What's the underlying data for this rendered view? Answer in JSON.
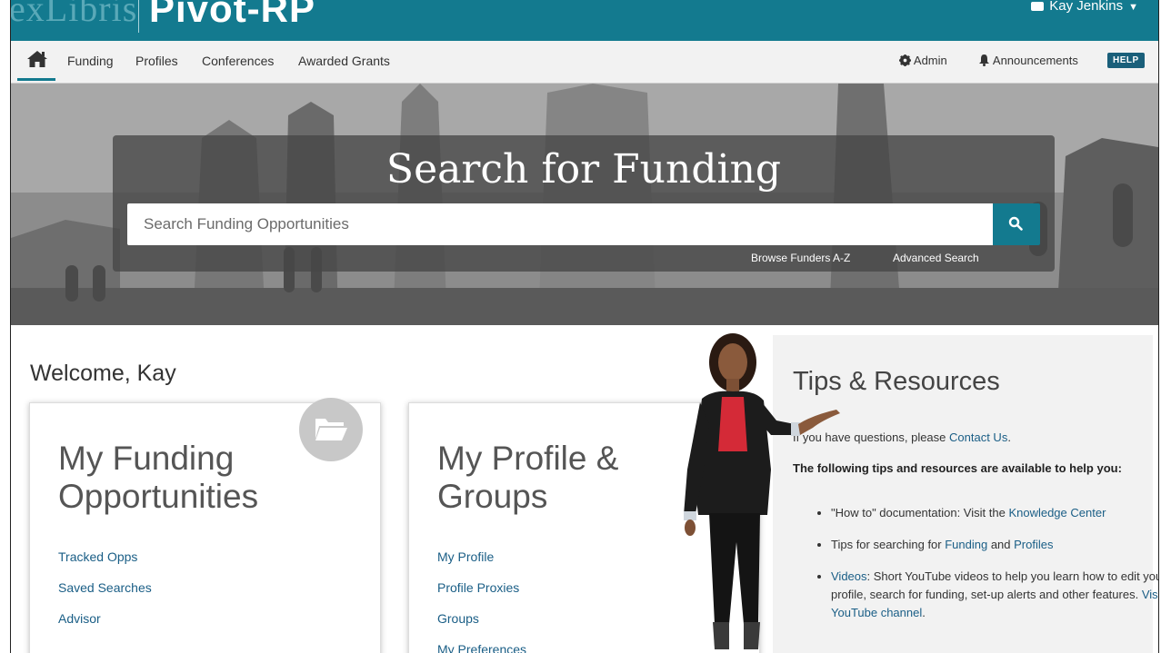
{
  "brand": {
    "prefix": "exLibris",
    "product": "Pivot-RP"
  },
  "user": {
    "name": "Kay Jenkins"
  },
  "nav": {
    "links": [
      "Funding",
      "Profiles",
      "Conferences",
      "Awarded Grants"
    ],
    "admin": "Admin",
    "announcements": "Announcements",
    "help": "HELP"
  },
  "search": {
    "title": "Search for Funding",
    "placeholder": "Search Funding Opportunities",
    "browse": "Browse Funders A-Z",
    "advanced": "Advanced Search"
  },
  "welcome": "Welcome, Kay",
  "card_funding": {
    "title_line1": "My Funding",
    "title_line2": "Opportunities",
    "links": [
      "Tracked Opps",
      "Saved Searches",
      "Advisor"
    ]
  },
  "card_profile": {
    "title_line1": "My Profile &",
    "title_line2": "Groups",
    "links": [
      "My Profile",
      "Profile Proxies",
      "Groups",
      "My Preferences"
    ]
  },
  "tips": {
    "title": "Tips & Resources",
    "intro_prefix": "If you have questions, please ",
    "intro_link": "Contact Us",
    "intro_suffix": ".",
    "lead": "The following tips and resources are available to help you:",
    "item1_prefix": "\"How to\" documentation: Visit the ",
    "item1_link": "Knowledge Center",
    "item2_prefix": "Tips for searching for ",
    "item2_link1": "Funding",
    "item2_mid": " and ",
    "item2_link2": "Profiles",
    "item3_link": "Videos",
    "item3_text": ": Short YouTube videos to help you learn how to edit your profile, search for funding, set-up alerts and other features. ",
    "item3_link2": "Visit the YouTube channel",
    "item3_suffix": "."
  },
  "colors": {
    "brand_teal": "#137a8f",
    "link_blue": "#1a5e86",
    "help_badge": "#1a5f7a"
  }
}
